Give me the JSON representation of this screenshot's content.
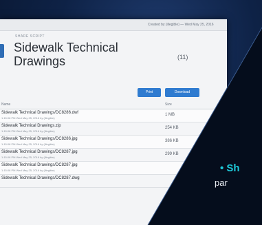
{
  "document": {
    "breadcrumb": "SHARE SCRIPT",
    "title": "Sidewalk Technical Drawings",
    "created": "Created by (illegible) — Wed May 25, 2016",
    "file_count": "(11)"
  },
  "toolbar": {
    "print_label": "Print",
    "download_label": "Download"
  },
  "table": {
    "columns": [
      "Name",
      "Size"
    ],
    "rows": [
      {
        "name": "Sidewalk Technical Drawings/DC8286.dwf",
        "meta": "1:15:08 PM Wed May 25, 2016 by (illegible)",
        "size": "1 MB"
      },
      {
        "name": "Sidewalk Technical Drawings.zip",
        "meta": "1:15:08 PM Wed May 25, 2016 by (illegible)",
        "size": "254 KB"
      },
      {
        "name": "Sidewalk Technical Drawings/DC8286.jpg",
        "meta": "1:15:08 PM Wed May 25, 2016 by (illegible)",
        "size": "386 KB"
      },
      {
        "name": "Sidewalk Technical Drawings/DC8287.jpg",
        "meta": "1:15:08 PM Wed May 25, 2016 by (illegible)",
        "size": "299 KB"
      },
      {
        "name": "Sidewalk Technical Drawings/DC8287.jpg",
        "meta": "1:15:08 PM Wed May 25, 2016 by (illegible)",
        "size": ""
      },
      {
        "name": "Sidewalk Technical Drawings/DC8287.dwg",
        "meta": "",
        "size": ""
      }
    ]
  },
  "overlay": {
    "bullet": "• Sh",
    "subtext": "par"
  },
  "colors": {
    "accent": "#2f7bd0",
    "overlay_dark": "#050d1c",
    "bullet_cyan": "#1ec8d8",
    "background": "#0b1a33"
  }
}
